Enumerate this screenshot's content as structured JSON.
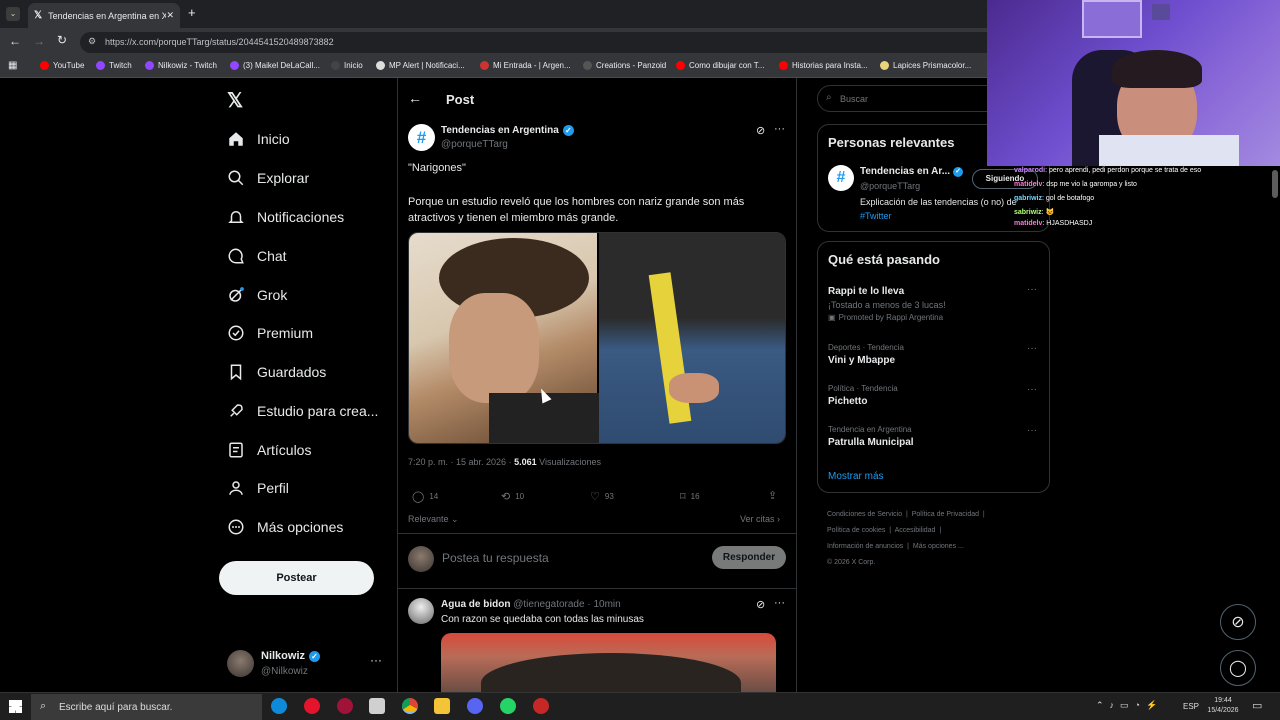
{
  "browser": {
    "tab_title": "Tendencias en Argentina en X: \"",
    "url": "https://x.com/porqueTTarg/status/2044541520489873882",
    "bookmarks": [
      "YouTube",
      "Twitch",
      "Nilkowiz - Twitch",
      "(3) Maikel DeLaCall...",
      "Inicio",
      "MP Alert | Notificaci...",
      "Mi Entrada - | Argen...",
      "Creations - Panzoid",
      "Como dibujar con T...",
      "Historias para Insta...",
      "Lapices Prismacolor..."
    ]
  },
  "sidebar": {
    "items": [
      {
        "label": "Inicio",
        "icon": "home-icon"
      },
      {
        "label": "Explorar",
        "icon": "search-icon"
      },
      {
        "label": "Notificaciones",
        "icon": "bell-icon"
      },
      {
        "label": "Chat",
        "icon": "chat-icon"
      },
      {
        "label": "Grok",
        "icon": "grok-icon"
      },
      {
        "label": "Premium",
        "icon": "premium-icon"
      },
      {
        "label": "Guardados",
        "icon": "bookmark-icon"
      },
      {
        "label": "Estudio para crea...",
        "icon": "rocket-icon"
      },
      {
        "label": "Artículos",
        "icon": "article-icon"
      },
      {
        "label": "Perfil",
        "icon": "profile-icon"
      },
      {
        "label": "Más opciones",
        "icon": "more-icon"
      }
    ],
    "post_button": "Postear",
    "account": {
      "name": "Nilkowiz",
      "handle": "@Nilkowiz"
    }
  },
  "post": {
    "header": "Post",
    "author": {
      "name": "Tendencias en Argentina",
      "handle": "@porqueTTarg"
    },
    "quote": "\"Narigones\"",
    "body": "Porque un estudio reveló que los hombres con nariz grande son más atractivos y tienen el miembro más grande.",
    "time": "7:20 p. m. · 15 abr. 2026 ·",
    "views": "5.061",
    "views_label": "Visualizaciones",
    "replies": "14",
    "reposts": "10",
    "likes": "93",
    "bookmarks": "16",
    "sort": "Relevante",
    "quotes": "Ver citas",
    "reply_placeholder": "Postea tu respuesta",
    "reply_button": "Responder"
  },
  "reply": {
    "name": "Agua de bidon",
    "handle": "@tienegatorade",
    "time": "10min",
    "text": "Con razon se quedaba con todas las minusas"
  },
  "right": {
    "search_placeholder": "Buscar",
    "relevant_title": "Personas relevantes",
    "relevant": {
      "name": "Tendencias en Ar...",
      "handle": "@porqueTTarg",
      "follow": "Siguiendo",
      "bio": "Explicación de las tendencias (o no) de",
      "tag": "#Twitter"
    },
    "happening_title": "Qué está pasando",
    "trends": [
      {
        "meta": "",
        "title": "Rappi te lo lleva",
        "sub": "¡Tostado a menos de 3 lucas!",
        "promo": "Promoted by Rappi Argentina"
      },
      {
        "meta": "Deportes · Tendencia",
        "title": "Vini y Mbappe"
      },
      {
        "meta": "Política · Tendencia",
        "title": "Pichetto"
      },
      {
        "meta": "Tendencia en Argentina",
        "title": "Patrulla Municipal"
      }
    ],
    "show_more": "Mostrar más",
    "footer": [
      "Condiciones de Servicio",
      "Política de Privacidad",
      "Política de cookies",
      "Accesibilidad",
      "Información de anuncios",
      "Más opciones ...",
      "© 2026 X Corp."
    ]
  },
  "stream_chat": [
    {
      "user": "valparodi",
      "msg": ": pero aprendi, pedi perdon porque se trata de eso",
      "color": "#c98cff"
    },
    {
      "user": "matidelv",
      "msg": ": dsp me vio la garompa y listo",
      "color": "#ff7ad9"
    },
    {
      "user": "gabriwiz",
      "msg": ": gol de botafogo",
      "color": "#6fd6ff"
    },
    {
      "user": "sabriwiz",
      "msg": ": 😺",
      "color": "#b4ff7a"
    },
    {
      "user": "matidelv",
      "msg": ": HJASDHASDJ",
      "color": "#ff7ad9"
    }
  ],
  "taskbar": {
    "search": "Escribe aquí para buscar.",
    "lang": "ESP",
    "time": "19:44",
    "date": "15/4/2026"
  }
}
